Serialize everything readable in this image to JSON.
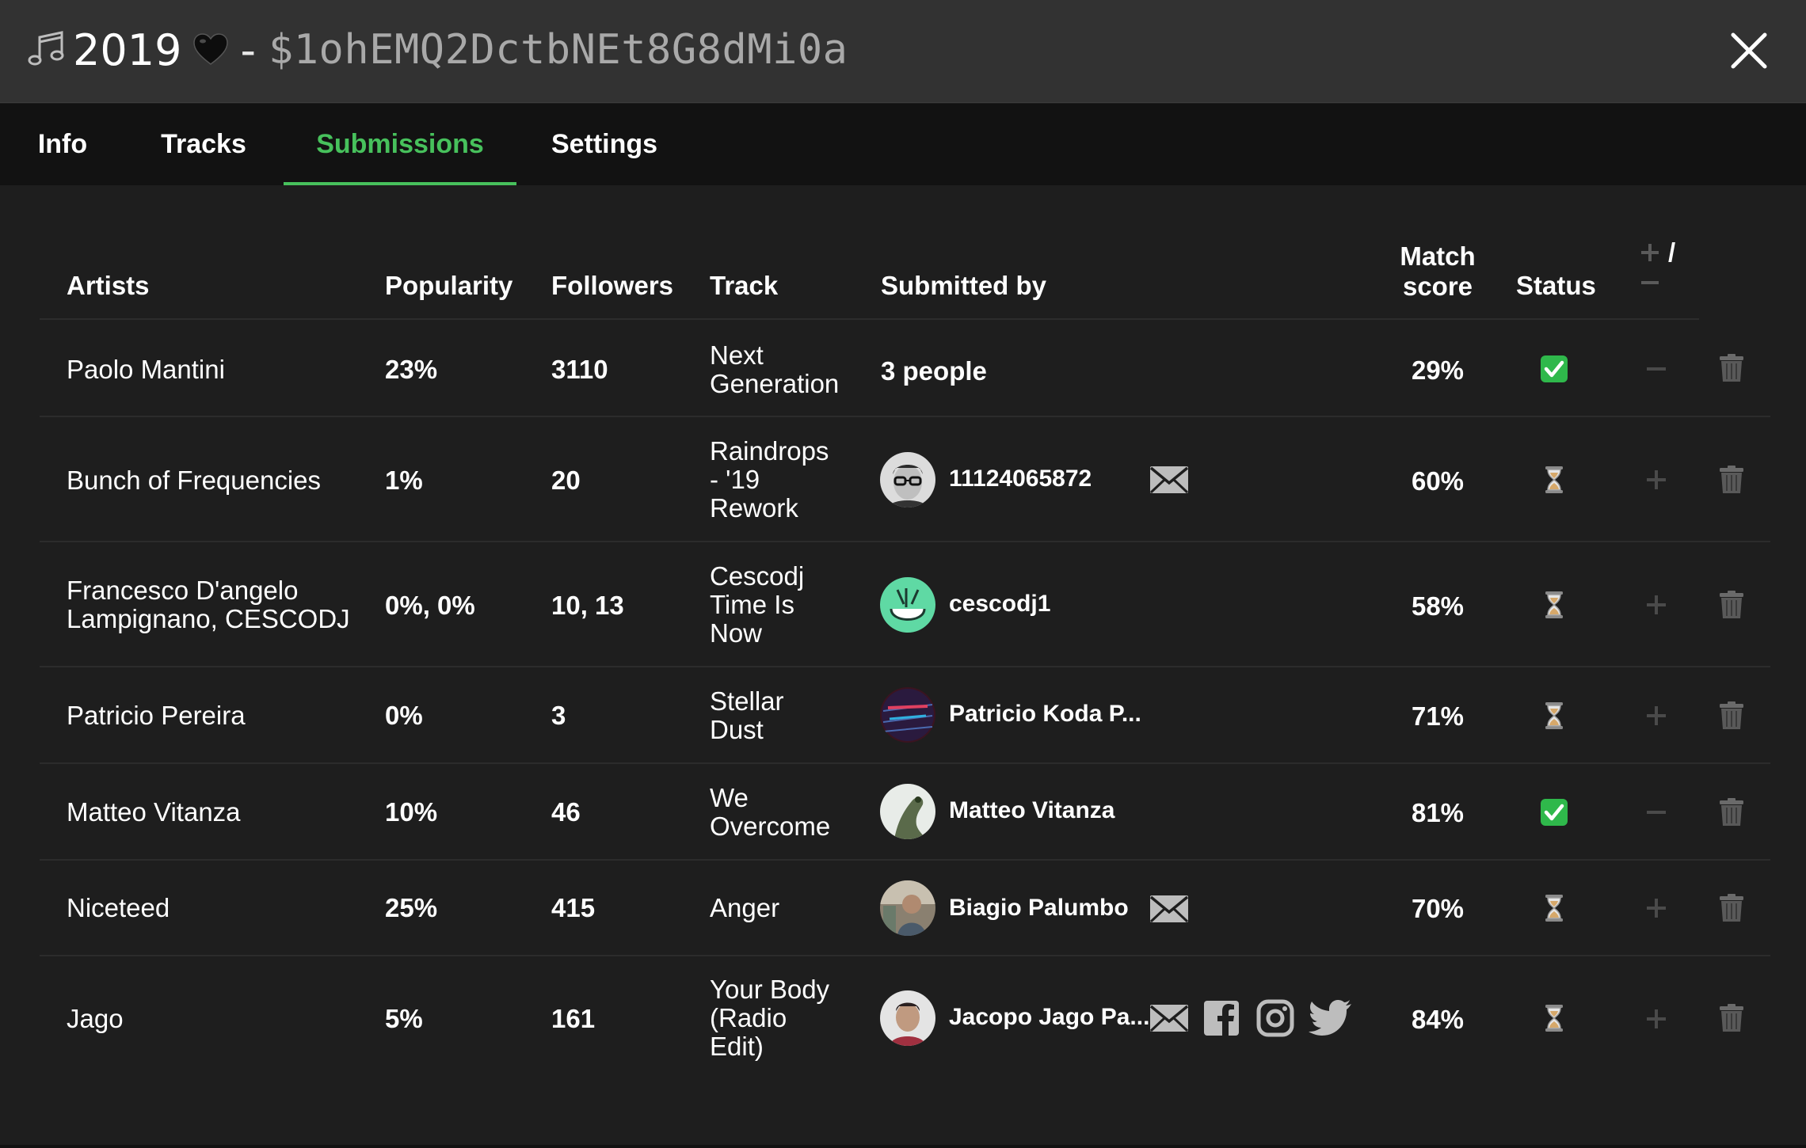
{
  "window": {
    "title_name": "2019",
    "title_sep": "-",
    "title_id": "$1ohEMQ2DctbNEt8G8dMi0a"
  },
  "tabs": [
    {
      "label": "Info",
      "active": false
    },
    {
      "label": "Tracks",
      "active": false
    },
    {
      "label": "Submissions",
      "active": true
    },
    {
      "label": "Settings",
      "active": false
    }
  ],
  "table": {
    "headers": {
      "artists": "Artists",
      "popularity": "Popularity",
      "followers": "Followers",
      "track": "Track",
      "submitted_by": "Submitted by",
      "match_score_1": "Match",
      "match_score_2": "score",
      "status": "Status",
      "add_remove": "/"
    },
    "rows": [
      {
        "artists": [
          "Paolo Mantini"
        ],
        "popularity": "23%",
        "followers": "3110",
        "track": [
          "Next",
          "Generation"
        ],
        "submitted_by": "3 people",
        "match_score": "29%",
        "status": "approved",
        "action": "remove"
      },
      {
        "artists": [
          "Bunch of Frequencies"
        ],
        "popularity": "1%",
        "followers": "20",
        "track": [
          "Raindrops",
          "- '19",
          "Rework"
        ],
        "submitted_by": "11124065872",
        "match_score": "60%",
        "status": "pending",
        "action": "add"
      },
      {
        "artists": [
          "Francesco D'angelo",
          "Lampignano, CESCODJ"
        ],
        "popularity": "0%, 0%",
        "followers": "10, 13",
        "track": [
          "Cescodj",
          "Time Is",
          "Now"
        ],
        "submitted_by": "cescodj1",
        "match_score": "58%",
        "status": "pending",
        "action": "add"
      },
      {
        "artists": [
          "Patricio Pereira"
        ],
        "popularity": "0%",
        "followers": "3",
        "track": [
          "Stellar",
          "Dust"
        ],
        "submitted_by": "Patricio Koda P...",
        "match_score": "71%",
        "status": "pending",
        "action": "add"
      },
      {
        "artists": [
          "Matteo Vitanza"
        ],
        "popularity": "10%",
        "followers": "46",
        "track": [
          "We",
          "Overcome"
        ],
        "submitted_by": "Matteo Vitanza",
        "match_score": "81%",
        "status": "approved",
        "action": "remove"
      },
      {
        "artists": [
          "Niceteed"
        ],
        "popularity": "25%",
        "followers": "415",
        "track": [
          "Anger"
        ],
        "submitted_by": "Biagio Palumbo",
        "match_score": "70%",
        "status": "pending",
        "action": "add"
      },
      {
        "artists": [
          "Jago"
        ],
        "popularity": "5%",
        "followers": "161",
        "track": [
          "Your Body",
          "(Radio",
          "Edit)"
        ],
        "submitted_by": "Jacopo Jago Pa...",
        "match_score": "84%",
        "status": "pending",
        "action": "add"
      }
    ]
  },
  "colors": {
    "accent": "#47c15c",
    "title_bar": "#323232",
    "background": "#1e1e1e",
    "tab_bar": "#121212",
    "muted_icon": "#5a5a5a"
  },
  "icons": {
    "title": "music-note-icon",
    "heart": "black-heart-icon",
    "close": "close-icon",
    "approved": "checkmark-icon",
    "pending": "hourglass-icon",
    "add": "plus-icon",
    "remove": "minus-icon",
    "delete": "trash-icon",
    "email": "envelope-icon",
    "facebook": "facebook-icon",
    "instagram": "instagram-icon",
    "twitter": "twitter-icon"
  }
}
